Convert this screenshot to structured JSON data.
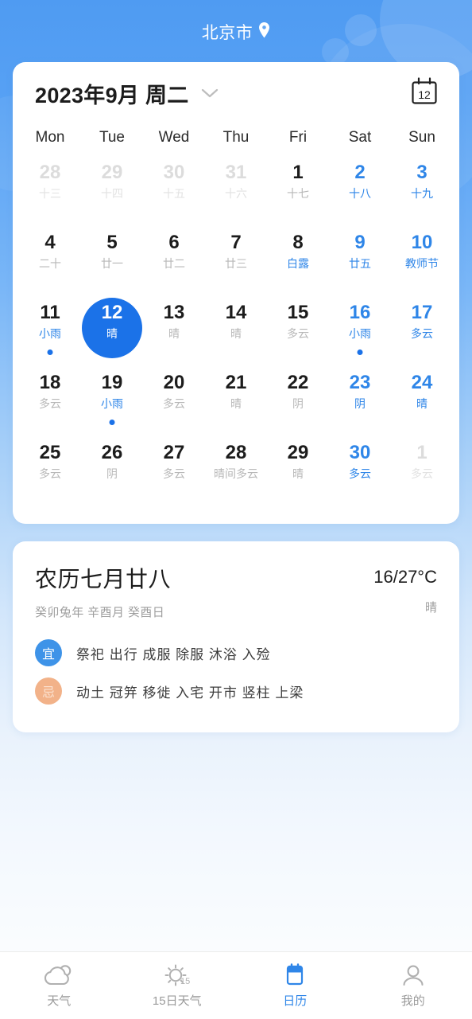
{
  "header": {
    "location": "北京市",
    "pin_icon": "location-pin-icon"
  },
  "calendar": {
    "title": "2023年9月 周二",
    "chevron_icon": "chevron-down-icon",
    "today_icon": "calendar-today-icon",
    "today_icon_number": "12",
    "weekdays": [
      "Mon",
      "Tue",
      "Wed",
      "Thu",
      "Fri",
      "Sat",
      "Sun"
    ],
    "days": [
      {
        "num": "28",
        "sub": "十三",
        "state": "muted"
      },
      {
        "num": "29",
        "sub": "十四",
        "state": "muted"
      },
      {
        "num": "30",
        "sub": "十五",
        "state": "muted"
      },
      {
        "num": "31",
        "sub": "十六",
        "state": "muted"
      },
      {
        "num": "1",
        "sub": "十七",
        "state": "normal"
      },
      {
        "num": "2",
        "sub": "十八",
        "state": "weekend"
      },
      {
        "num": "3",
        "sub": "十九",
        "state": "weekend"
      },
      {
        "num": "4",
        "sub": "二十",
        "state": "normal"
      },
      {
        "num": "5",
        "sub": "廿一",
        "state": "normal"
      },
      {
        "num": "6",
        "sub": "廿二",
        "state": "normal"
      },
      {
        "num": "7",
        "sub": "廿三",
        "state": "normal"
      },
      {
        "num": "8",
        "sub": "白露",
        "state": "normal",
        "sub_color": "accent"
      },
      {
        "num": "9",
        "sub": "廿五",
        "state": "weekend"
      },
      {
        "num": "10",
        "sub": "教师节",
        "state": "weekend"
      },
      {
        "num": "11",
        "sub": "小雨",
        "state": "normal",
        "sub_color": "accent",
        "dot": true
      },
      {
        "num": "12",
        "sub": "晴",
        "state": "selected"
      },
      {
        "num": "13",
        "sub": "晴",
        "state": "normal"
      },
      {
        "num": "14",
        "sub": "晴",
        "state": "normal"
      },
      {
        "num": "15",
        "sub": "多云",
        "state": "normal"
      },
      {
        "num": "16",
        "sub": "小雨",
        "state": "weekend",
        "dot": true
      },
      {
        "num": "17",
        "sub": "多云",
        "state": "weekend"
      },
      {
        "num": "18",
        "sub": "多云",
        "state": "normal"
      },
      {
        "num": "19",
        "sub": "小雨",
        "state": "normal",
        "sub_color": "accent",
        "dot": true
      },
      {
        "num": "20",
        "sub": "多云",
        "state": "normal"
      },
      {
        "num": "21",
        "sub": "晴",
        "state": "normal"
      },
      {
        "num": "22",
        "sub": "阴",
        "state": "normal"
      },
      {
        "num": "23",
        "sub": "阴",
        "state": "weekend",
        "sub_color": "gray"
      },
      {
        "num": "24",
        "sub": "晴",
        "state": "weekend",
        "sub_color": "gray"
      },
      {
        "num": "25",
        "sub": "多云",
        "state": "normal"
      },
      {
        "num": "26",
        "sub": "阴",
        "state": "normal"
      },
      {
        "num": "27",
        "sub": "多云",
        "state": "normal"
      },
      {
        "num": "28",
        "sub": "晴间多云",
        "state": "normal"
      },
      {
        "num": "29",
        "sub": "晴",
        "state": "normal"
      },
      {
        "num": "30",
        "sub": "多云",
        "state": "weekend",
        "sub_color": "gray"
      },
      {
        "num": "1",
        "sub": "多云",
        "state": "muted"
      }
    ]
  },
  "detail": {
    "lunar_main": "农历七月廿八",
    "lunar_sub": "癸卯兔年 辛酉月 癸酉日",
    "temperature": "16/27°C",
    "weather": "晴",
    "yi_badge": "宜",
    "yi_items": "祭祀 出行 成服 除服 沐浴 入殓",
    "ji_badge": "忌",
    "ji_items": "动土 冠笄 移徙 入宅 开市 竖柱 上梁"
  },
  "nav": {
    "items": [
      {
        "label": "天气",
        "icon": "cloud-sun-icon",
        "active": false
      },
      {
        "label": "15日天气",
        "icon": "sun-15-day-icon",
        "active": false
      },
      {
        "label": "日历",
        "icon": "calendar-icon",
        "active": true
      },
      {
        "label": "我的",
        "icon": "person-icon",
        "active": false
      }
    ]
  },
  "colors": {
    "accent": "#2f86e8",
    "selected": "#1b72e8",
    "yi_badge": "#3e93e8",
    "ji_badge": "#f2b289"
  }
}
